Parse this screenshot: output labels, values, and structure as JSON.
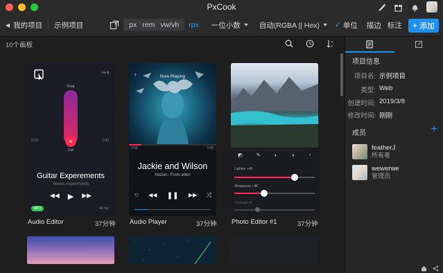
{
  "window": {
    "title": "PxCook"
  },
  "toolbar": {
    "my_projects": "我的项目",
    "sample_project": "示例项目",
    "units": [
      "px",
      "rem",
      "vw/vh"
    ],
    "unit_rpx": "rpx",
    "decimal": "一位小数",
    "color_format": "自动(RGBA || Hex)",
    "unit_toggle": "单位",
    "stroke": "描边",
    "annotate": "标注",
    "add": "添加"
  },
  "subbar": {
    "count": "10个画板"
  },
  "panel": {
    "project_info_title": "项目信息",
    "rows": [
      {
        "key": "项目名:",
        "value": "示例项目"
      },
      {
        "key": "类型:",
        "value": "Web"
      },
      {
        "key": "创建时间:",
        "value": "2019/3/8"
      },
      {
        "key": "修改时间:",
        "value": "刚刚"
      }
    ],
    "members_title": "成员",
    "members": [
      {
        "name": "featherJ",
        "role": "所有者"
      },
      {
        "name": "wewerwe",
        "role": "管理员"
      }
    ]
  },
  "cards": [
    {
      "label": "Audio Editor",
      "time": "37分钟"
    },
    {
      "label": "Audio Player",
      "time": "37分钟"
    },
    {
      "label": "Photo Editor #1",
      "time": "37分钟"
    }
  ],
  "audio_editor": {
    "title": "Guitar Experements",
    "subtitle": "Waves experiments",
    "badge": "MP3",
    "rate": "44 Hz",
    "crop": "Crop",
    "cut": "Cut",
    "t_left": "0:25",
    "t_right": "1:90"
  },
  "audio_player": {
    "now_playing": "Now Playing",
    "title": "Jackie and Wilson",
    "subtitle": "Hozier– From eden",
    "t_left": "0:58",
    "t_right": "3:58"
  },
  "photo_editor": {
    "lighten": "Lighten +40",
    "sharpness": "Sharpness +48",
    "contrast": "Contrast +0"
  },
  "colors": {
    "accent": "#1e90ef",
    "bg": "#1e1e1f",
    "panel": "#262627"
  }
}
